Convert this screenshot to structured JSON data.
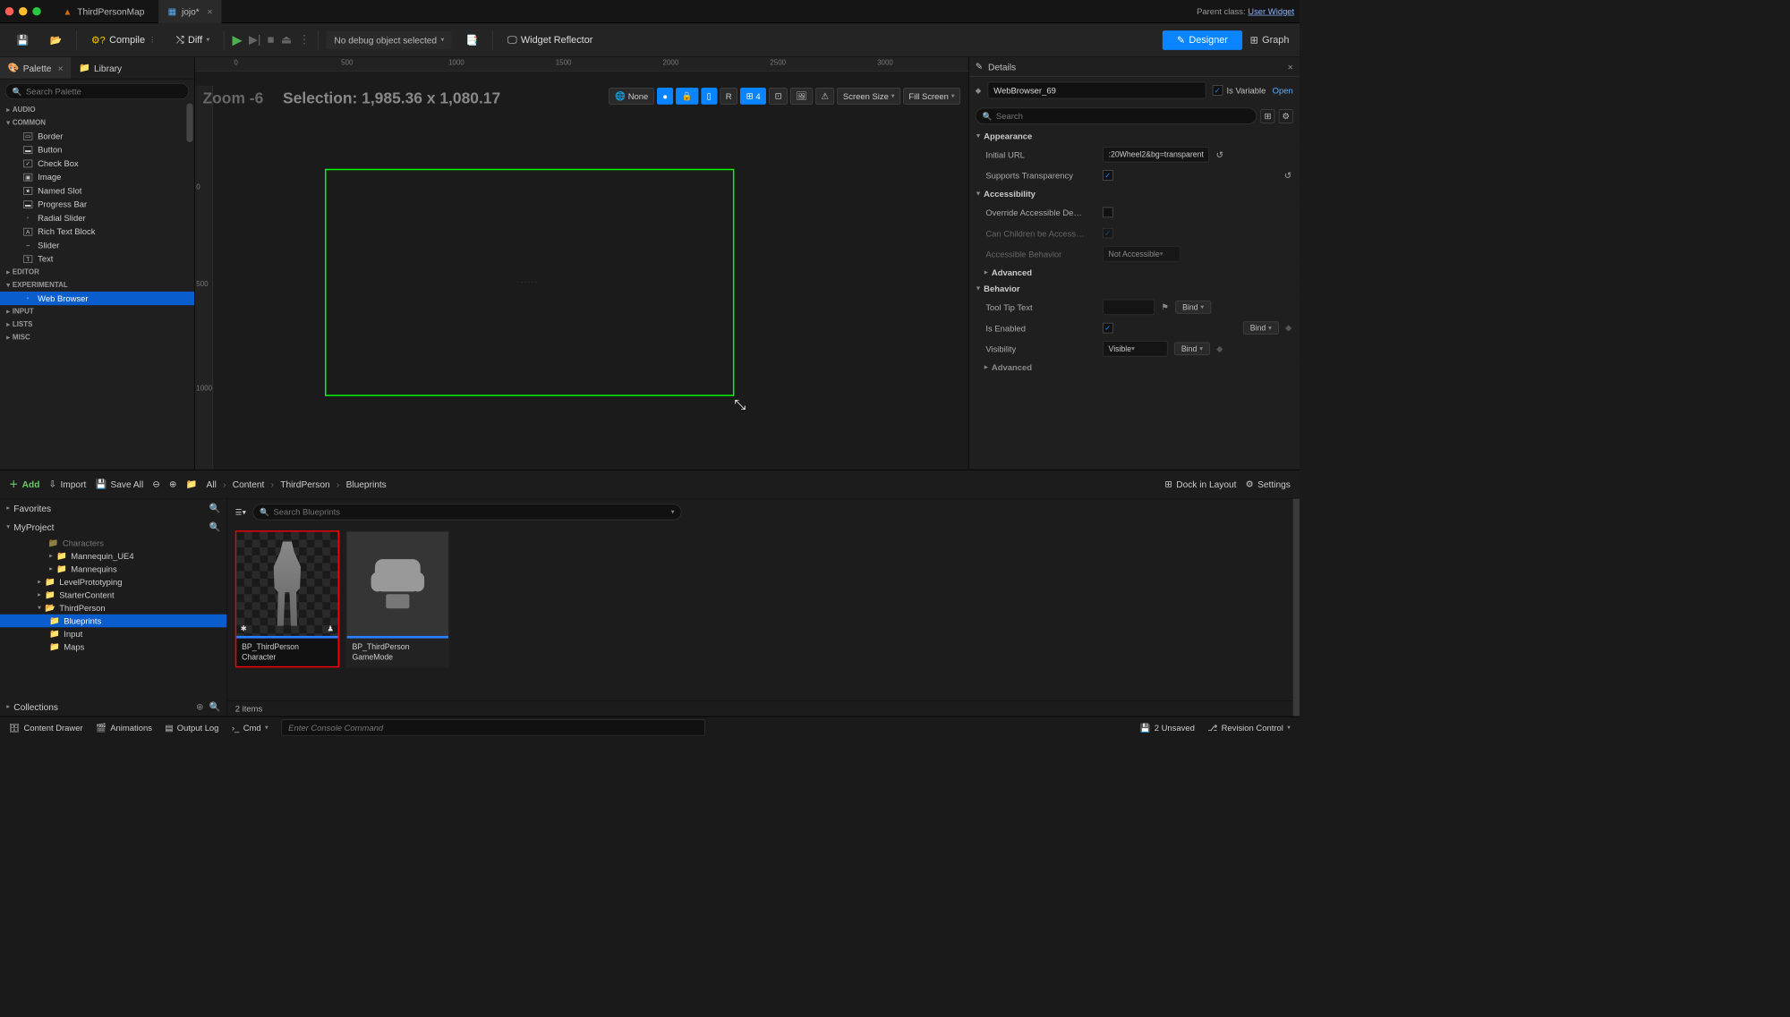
{
  "titlebar": {
    "tab1": "ThirdPersonMap",
    "tab2": "jojo*",
    "parent_label": "Parent class:",
    "parent_class": "User Widget"
  },
  "toolbar": {
    "compile": "Compile",
    "diff": "Diff",
    "debug_sel": "No debug object selected",
    "reflector": "Widget Reflector",
    "designer": "Designer",
    "graph": "Graph"
  },
  "palette": {
    "tab_palette": "Palette",
    "tab_library": "Library",
    "search_ph": "Search Palette",
    "cats": {
      "audio": "AUDIO",
      "common": "COMMON",
      "editor": "EDITOR",
      "experimental": "EXPERIMENTAL",
      "input": "INPUT",
      "lists": "LISTS",
      "misc": "MISC"
    },
    "common_items": [
      "Border",
      "Button",
      "Check Box",
      "Image",
      "Named Slot",
      "Progress Bar",
      "Radial Slider",
      "Rich Text Block",
      "Slider",
      "Text"
    ],
    "exp_items": [
      "Web Browser"
    ]
  },
  "canvas": {
    "zoom": "Zoom -6",
    "selection": "Selection: 1,985.36 x 1,080.17",
    "none": "None",
    "r": "R",
    "four": "4",
    "screen": "Screen Size",
    "fill": "Fill Screen",
    "ruler_h": [
      "0",
      "500",
      "1000",
      "1500",
      "2000",
      "2500",
      "3000"
    ],
    "ruler_v": [
      "0",
      "500",
      "1000"
    ]
  },
  "details": {
    "title": "Details",
    "name": "WebBrowser_69",
    "is_variable": "Is Variable",
    "open": "Open",
    "search_ph": "Search",
    "sections": {
      "appearance": "Appearance",
      "accessibility": "Accessibility",
      "behavior": "Behavior",
      "advanced": "Advanced"
    },
    "props": {
      "initial_url": "Initial URL",
      "initial_url_val": ":20Wheel2&bg=transparent",
      "transparency": "Supports Transparency",
      "override_acc": "Override Accessible De…",
      "children_acc": "Can Children be Access…",
      "acc_behavior": "Accessible Behavior",
      "acc_behavior_val": "Not Accessible",
      "tooltip": "Tool Tip Text",
      "enabled": "Is Enabled",
      "visibility": "Visibility",
      "visibility_val": "Visible",
      "bind": "Bind"
    }
  },
  "content": {
    "add": "Add",
    "import": "Import",
    "save_all": "Save All",
    "all": "All",
    "crumbs": [
      "Content",
      "ThirdPerson",
      "Blueprints"
    ],
    "dock": "Dock in Layout",
    "settings": "Settings",
    "favorites": "Favorites",
    "myproject": "MyProject",
    "collections": "Collections",
    "search_ph": "Search Blueprints",
    "folders": {
      "characters": "Characters",
      "mue4": "Mannequin_UE4",
      "mannequins": "Mannequins",
      "levelproto": "LevelPrototyping",
      "starter": "StarterContent",
      "thirdperson": "ThirdPerson",
      "blueprints": "Blueprints",
      "input": "Input",
      "maps": "Maps"
    },
    "assets": {
      "bp_char": "BP_ThirdPerson Character",
      "bp_game": "BP_ThirdPerson GameMode"
    },
    "items_count": "2 items"
  },
  "statusbar": {
    "drawer": "Content Drawer",
    "anim": "Animations",
    "output": "Output Log",
    "cmd": "Cmd",
    "console_ph": "Enter Console Command",
    "unsaved": "2 Unsaved",
    "revision": "Revision Control"
  }
}
